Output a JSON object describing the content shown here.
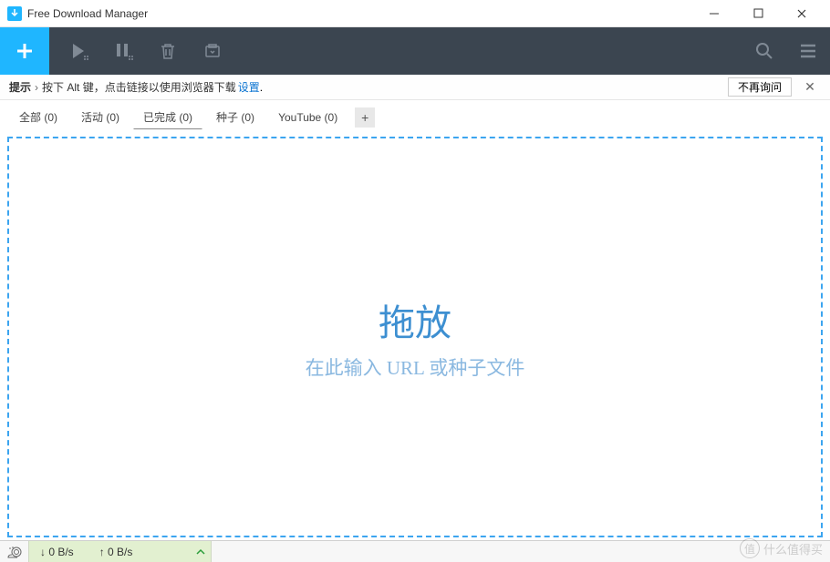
{
  "window": {
    "title": "Free Download Manager"
  },
  "hint": {
    "label": "提示",
    "text": "按下 Alt 键，点击链接以使用浏览器下载",
    "link": "设置",
    "dismiss": "不再询问"
  },
  "tabs": [
    {
      "label": "全部 (0)",
      "active": false
    },
    {
      "label": "活动 (0)",
      "active": false
    },
    {
      "label": "已完成 (0)",
      "active": true
    },
    {
      "label": "种子 (0)",
      "active": false
    },
    {
      "label": "YouTube (0)",
      "active": false
    }
  ],
  "dropzone": {
    "title": "拖放",
    "subtitle": "在此输入 URL 或种子文件"
  },
  "status": {
    "down": "↓ 0 B/s",
    "up": "↑ 0 B/s"
  },
  "watermark": {
    "badge": "值",
    "text": "什么值得买"
  }
}
